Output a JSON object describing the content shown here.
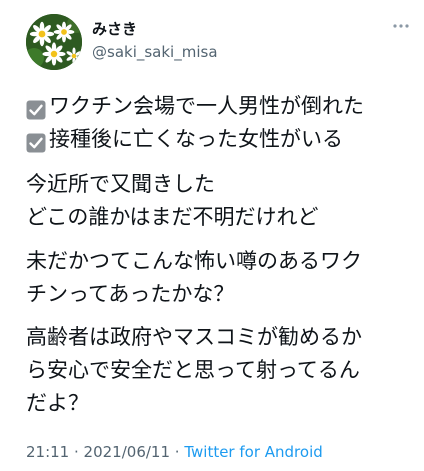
{
  "user": {
    "display_name": "みさき",
    "handle": "@saki_saki_misa",
    "avatar_icon": "daisy-flowers-avatar-icon"
  },
  "menu": {
    "icon": "more-horizontal-icon"
  },
  "tweet": {
    "checklist": [
      {
        "icon": "checkbox-checked-icon",
        "text": "ワクチン会場で一人男性が倒れた"
      },
      {
        "icon": "checkbox-checked-icon",
        "text": "接種後に亡くなった女性がいる"
      }
    ],
    "paragraphs": [
      [
        "今近所で又聞きした",
        "どこの誰かはまだ不明だけれど"
      ],
      [
        "未だかつてこんな怖い噂のあるワク",
        "チンってあったかな？"
      ],
      [
        "高齢者は政府やマスコミが勧めるか",
        "ら安心で安全だと思って射ってるん",
        "だよ？"
      ]
    ]
  },
  "meta": {
    "time": "21:11",
    "separator": " · ",
    "date": "2021/06/11",
    "source": "Twitter for Android"
  },
  "colors": {
    "text": "#0f1419",
    "secondary": "#536471",
    "link": "#1d9bf0",
    "checkbox": "#8a8f94"
  }
}
